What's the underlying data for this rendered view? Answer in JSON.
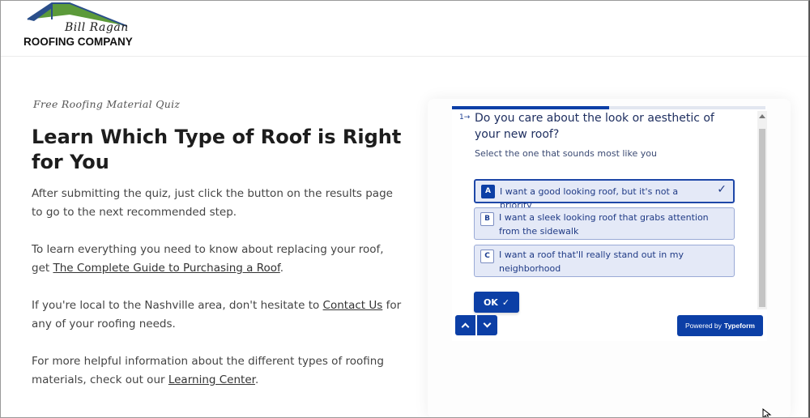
{
  "brand": {
    "script_name": "Bill Ragan",
    "company_name": "ROOFING COMPANY",
    "colors": {
      "roof_green": "#5c9a3a",
      "roof_blue": "#2b4f8a"
    }
  },
  "content": {
    "eyebrow": "Free Roofing Material Quiz",
    "title": "Learn Which Type of Roof is Right for You",
    "p1": "After submitting the quiz, just click the button on the results page to go to the next recommended step.",
    "p2_before": "To learn everything you need to know about replacing your roof, get ",
    "p2_link": "The Complete Guide to Purchasing a Roof",
    "p2_after": ".",
    "p3_before": "If you're local to the Nashville area, don't hesitate to ",
    "p3_link": "Contact Us",
    "p3_after": " for any of your roofing needs.",
    "p4_before": "For more helpful information about the different types of roofing materials, check out our ",
    "p4_link": "Learning Center",
    "p4_after": "."
  },
  "quiz": {
    "progress": 0.5,
    "question_number": "1→",
    "question": "Do you care about the look or aesthetic of your new roof?",
    "subtitle": "Select the one that sounds most like you",
    "choices": [
      {
        "key": "A",
        "label": "I want a good looking roof, but it's not a priority",
        "selected": true
      },
      {
        "key": "B",
        "label": "I want a sleek looking roof that grabs attention from the sidewalk",
        "selected": false
      },
      {
        "key": "C",
        "label": "I want a roof that'll really stand out in my neighborhood",
        "selected": false
      }
    ],
    "ok_label": "OK",
    "check_icon": "✓",
    "powered_prefix": "Powered by",
    "powered_brand": "Typeform",
    "accent_color": "#0c3fa6"
  }
}
